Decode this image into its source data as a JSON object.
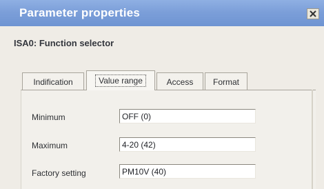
{
  "window": {
    "title": "Parameter properties",
    "close_icon": "close-icon"
  },
  "header": {
    "subtitle": "ISA0: Function selector"
  },
  "tabs": [
    {
      "label": "Indification",
      "active": false
    },
    {
      "label": "Value range",
      "active": true
    },
    {
      "label": "Access",
      "active": false
    },
    {
      "label": "Format",
      "active": false
    }
  ],
  "fields": {
    "minimum": {
      "label": "Minimum",
      "value": "OFF (0)"
    },
    "maximum": {
      "label": "Maximum",
      "value": "4-20 (42)"
    },
    "factory_setting": {
      "label": "Factory setting",
      "value": "PM10V (40)"
    }
  }
}
